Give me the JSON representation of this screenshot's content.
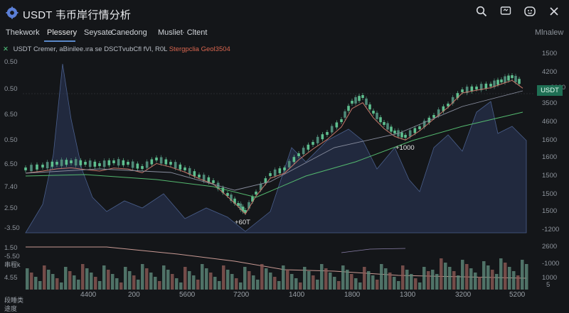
{
  "header": {
    "title": "USDT 韦币岸行情分析",
    "icons": [
      "search-icon",
      "chat-icon",
      "alert-icon",
      "close-icon"
    ]
  },
  "tabs": [
    {
      "label": "Thekwork"
    },
    {
      "label": "Plessery"
    },
    {
      "label": "Seysate"
    },
    {
      "label": "Canedong"
    },
    {
      "label": "Musliet"
    },
    {
      "label": "· Cltent"
    }
  ],
  "right_tab": "Mlnalew",
  "legend": {
    "text": "USDT Cremer, aBinilee.ıra se DSCTvubCfl fVl, R0L",
    "highlight": "Stergpclia Geol3504"
  },
  "axes": {
    "left": [
      "0.50",
      "0.50",
      "6.50",
      "0.50",
      "6.50",
      "7.40",
      "2.50",
      "-3.50",
      "1.50",
      "-5.50",
      "4.55"
    ],
    "right": [
      "1500",
      "4200",
      "2000",
      "3500",
      "4600",
      "1600",
      "1600",
      "1500",
      "1500",
      "-1200",
      "2600",
      "-1000",
      "1000",
      "5"
    ],
    "x": [
      "4400",
      "200",
      "5600",
      "7200",
      "1400",
      "1800",
      "1300",
      "3200",
      "5200"
    ],
    "corner_top": "串程k",
    "corner_mid": "段睡类",
    "corner_bottom": "途度"
  },
  "price_tag": "USDT",
  "annotations": [
    "+60T",
    "+1000"
  ],
  "colors": {
    "up": "#5fbf8f",
    "down": "#4f8a78",
    "ma1": "#c7776a",
    "ma2": "#54b96f",
    "ma3": "#8a8fa0",
    "area": "#2b3a5c"
  }
}
